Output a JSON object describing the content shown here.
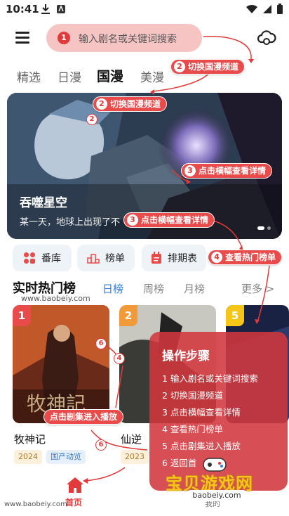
{
  "status_bar": {
    "time": "10:41"
  },
  "search": {
    "step_num": "1",
    "placeholder": "输入剧名或关键词搜索"
  },
  "tabs": [
    {
      "label": "精选",
      "active": false
    },
    {
      "label": "日漫",
      "active": false
    },
    {
      "label": "国漫",
      "active": true
    },
    {
      "label": "美漫",
      "active": false
    }
  ],
  "callouts": {
    "switch_channel_a": {
      "num": "2",
      "text": "切换国漫频道"
    },
    "switch_channel_b": {
      "num": "2",
      "text": "切换国漫频道"
    },
    "badge_2": "2",
    "banner_detail_a": {
      "num": "3",
      "text": "点击横幅查看详情"
    },
    "banner_detail_b": {
      "num": "3",
      "text": "点击横幅查看详情"
    },
    "hot_list": {
      "num": "4",
      "text": "查看热门榜单"
    },
    "play_episode": {
      "text": "点击剧集进入播放"
    },
    "badge_6a": "6",
    "badge_4": "4",
    "badge_6b": "6"
  },
  "banner": {
    "title": "吞噬星空",
    "subtitle": "某一天，地球上出现了不"
  },
  "quick_links": [
    {
      "label": "番库",
      "icon": "grid-icon"
    },
    {
      "label": "榜单",
      "icon": "podium-icon"
    },
    {
      "label": "排期表",
      "icon": "calendar-icon"
    }
  ],
  "hot": {
    "title": "实时热门榜",
    "tabs": [
      {
        "label": "日榜",
        "active": true
      },
      {
        "label": "周榜",
        "active": false
      },
      {
        "label": "月榜",
        "active": false
      }
    ],
    "more": "更多 >",
    "watermark": "www.baobeiy.com"
  },
  "cards": [
    {
      "rank": "1",
      "name": "牧神记",
      "year": "2024",
      "genre": "国产动览",
      "rank_color": "#e94a4a"
    },
    {
      "rank": "2",
      "name": "仙逆",
      "year": "2023",
      "genre": "",
      "rank_color": "#f09a3a"
    },
    {
      "rank": "5",
      "name": "",
      "year": "",
      "genre": "",
      "rank_color": "#f5c518"
    }
  ],
  "steps": {
    "title": "操作步骤",
    "items": [
      "1 输入剧名或关键词搜索",
      "2 切换国漫频道",
      "3 点击横幅查看详情",
      "4 查看热门榜单",
      "5 点击剧集进入播放",
      "6 返回首"
    ]
  },
  "bottom_nav": {
    "home_label": "首页",
    "mine_label": "我的"
  },
  "watermarks": {
    "bottom_left": "www.baobeiy.com",
    "logo_text": "宝贝游戏网",
    "logo_url": "baobeiy.com"
  },
  "colors": {
    "accent_red": "#e23a3a",
    "search_bg": "#f7c4c4",
    "active_blue": "#2f7de1",
    "quick_bg": "#eef3f8"
  }
}
